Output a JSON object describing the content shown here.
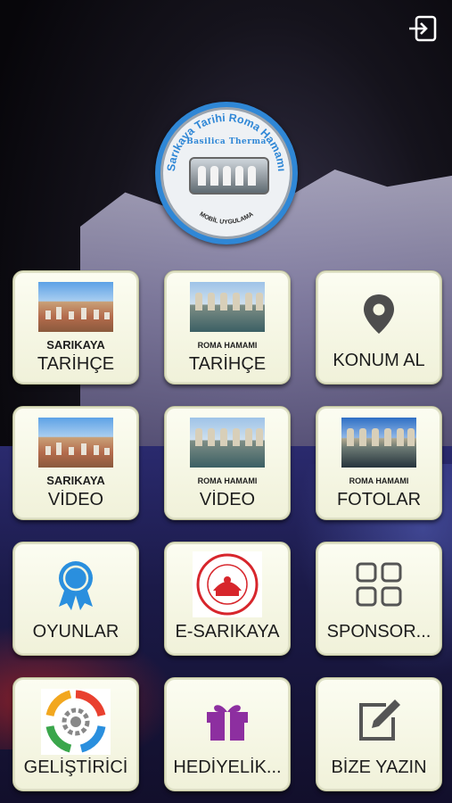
{
  "header": {
    "logo_title": "Sarıkaya Tarihi Roma Hamamı",
    "logo_subtitle": "Basilica Therma",
    "logo_footer": "MOBİL UYGULAMA"
  },
  "icons": {
    "exit": "exit-icon",
    "location": "map-pin-icon",
    "badge": "award-ribbon-icon",
    "seal": "seal-emblem-icon",
    "apps": "grid-apps-icon",
    "gear": "settings-gear-icon",
    "gift": "gift-icon",
    "edit": "edit-pencil-icon"
  },
  "colors": {
    "tile_bg": "#f4f5e1",
    "tile_border": "#bfc29a",
    "logo_blue": "#2f87d6",
    "pin": "#4d4d4d",
    "ribbon": "#2a8fde",
    "gift": "#8d2fa0"
  },
  "tiles": [
    {
      "sub": "SARIKAYA",
      "label": "TARİHÇE"
    },
    {
      "sub": "ROMA HAMAMI",
      "label": "TARİHÇE"
    },
    {
      "sub": "",
      "label": "KONUM AL"
    },
    {
      "sub": "SARIKAYA",
      "label": "VİDEO"
    },
    {
      "sub": "ROMA HAMAMI",
      "label": "VİDEO"
    },
    {
      "sub": "ROMA HAMAMI",
      "label": "FOTOLAR"
    },
    {
      "sub": "",
      "label": "OYUNLAR"
    },
    {
      "sub": "",
      "label": "E-SARIKAYA"
    },
    {
      "sub": "",
      "label": "SPONSOR..."
    },
    {
      "sub": "",
      "label": "GELİŞTİRİCİ"
    },
    {
      "sub": "",
      "label": "HEDİYELİK..."
    },
    {
      "sub": "",
      "label": "BİZE YAZIN"
    }
  ]
}
